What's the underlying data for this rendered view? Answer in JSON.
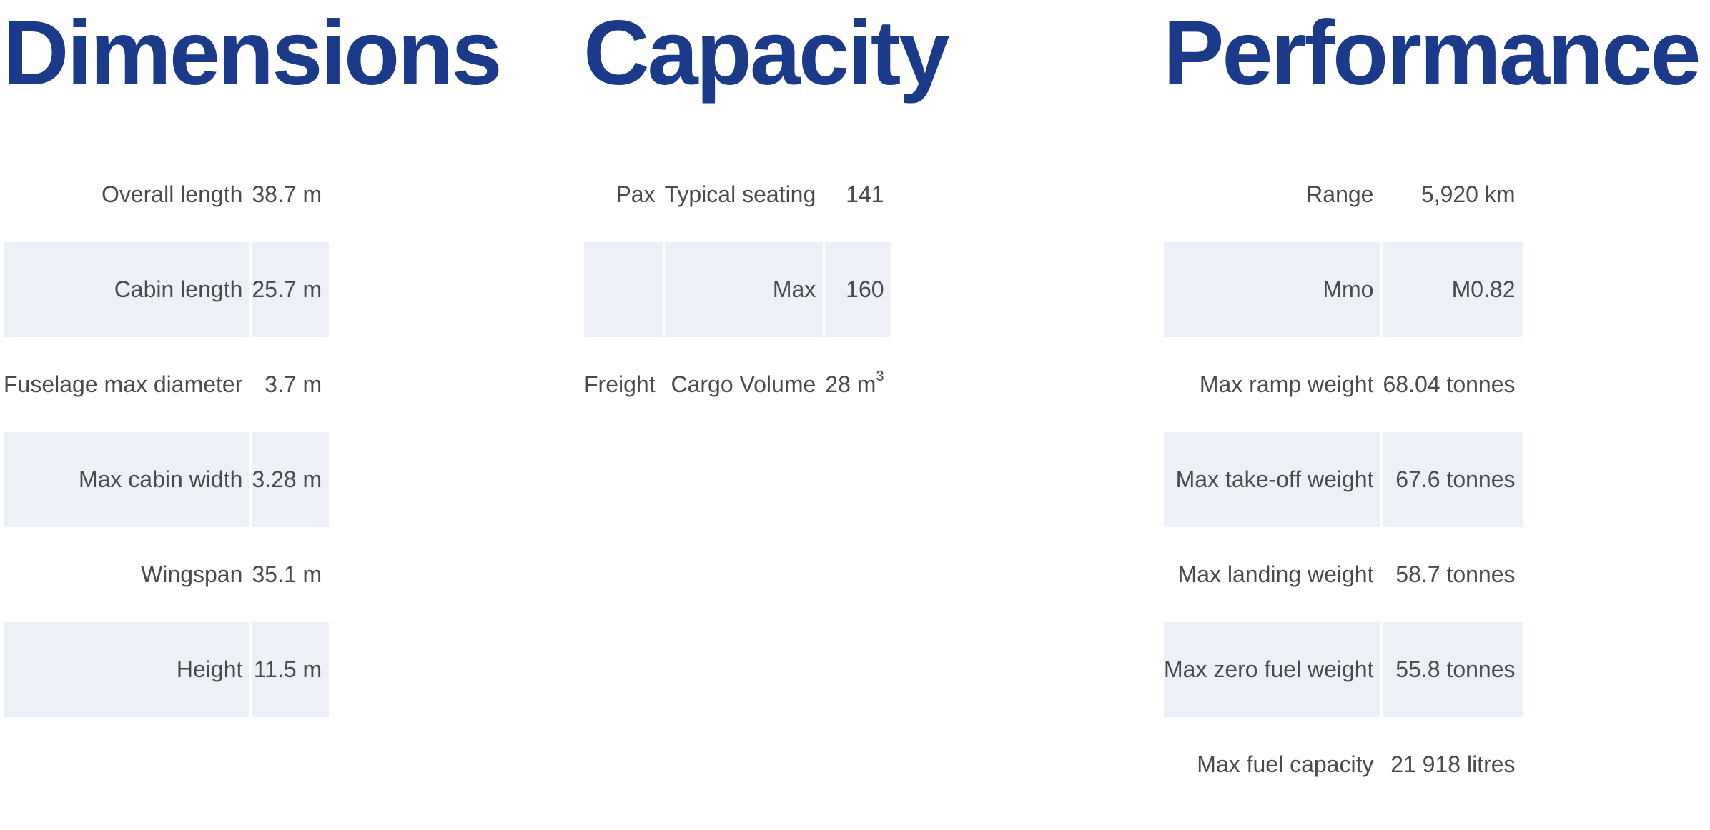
{
  "dimensions": {
    "title": "Dimensions",
    "rows": [
      {
        "label": "Overall length",
        "value": "38.7 m"
      },
      {
        "label": "Cabin length",
        "value": "25.7 m"
      },
      {
        "label": "Fuselage max diameter",
        "value": "3.7 m"
      },
      {
        "label": "Max cabin width",
        "value": "3.28 m"
      },
      {
        "label": "Wingspan",
        "value": "35.1 m"
      },
      {
        "label": "Height",
        "value": "11.5 m"
      }
    ]
  },
  "capacity": {
    "title": "Capacity",
    "rows": [
      {
        "group": "Pax",
        "label": "Typical seating",
        "value": "141"
      },
      {
        "group": "",
        "label": "Max",
        "value": "160"
      },
      {
        "group": "Freight",
        "label": "Cargo Volume",
        "value": "28 m",
        "value_sup": "3"
      }
    ]
  },
  "performance": {
    "title": "Performance",
    "rows": [
      {
        "label": "Range",
        "value": "5,920 km"
      },
      {
        "label": "Mmo",
        "value": "M0.82"
      },
      {
        "label": "Max ramp weight",
        "value": "68.04 tonnes"
      },
      {
        "label": "Max take-off weight",
        "value": "67.6 tonnes"
      },
      {
        "label": "Max landing weight",
        "value": "58.7 tonnes"
      },
      {
        "label": "Max zero fuel weight",
        "value": "55.8 tonnes"
      },
      {
        "label": "Max fuel capacity",
        "value": "21 918 litres"
      }
    ]
  },
  "colors": {
    "heading": "#1b3a8a",
    "text": "#4a4a4a",
    "row_shade": "#edf0f7"
  }
}
